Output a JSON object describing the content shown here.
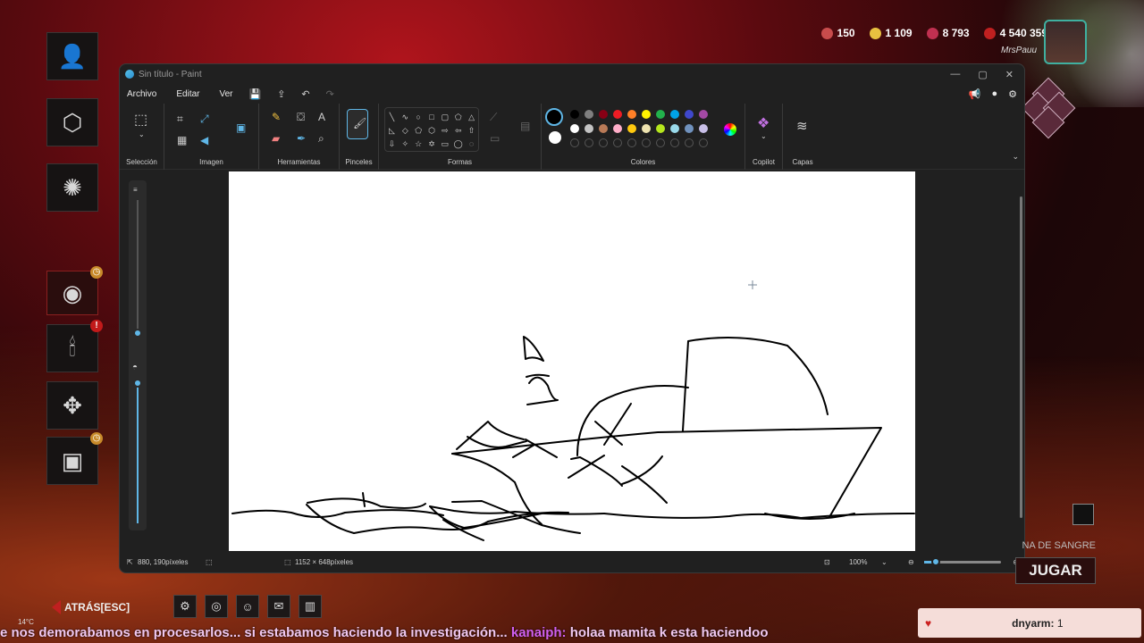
{
  "game": {
    "currencies": [
      {
        "icon": "shards-icon",
        "value": "150",
        "color": "#c84c4c"
      },
      {
        "icon": "iridescent-shards-icon",
        "value": "1 109",
        "color": "#e8c040"
      },
      {
        "icon": "auric-cells-icon",
        "value": "8 793",
        "color": "#c03050"
      },
      {
        "icon": "bloodpoints-icon",
        "value": "4 540 359",
        "color": "#c02020"
      }
    ],
    "player_name": "MrsPauu",
    "back_label": "ATRÁS",
    "back_key": "[ESC]",
    "play_label": "JUGAR",
    "bloodweb_label": "NA DE SANGRE"
  },
  "paint": {
    "window_title": "Sin título - Paint",
    "menus": [
      "Archivo",
      "Editar",
      "Ver"
    ],
    "groups": {
      "selection": "Selección",
      "image": "Imagen",
      "tools": "Herramientas",
      "brushes": "Pinceles",
      "shapes": "Formas",
      "colors": "Colores",
      "copilot": "Copilot",
      "layers": "Capas"
    },
    "palette_row1": [
      "#000000",
      "#7f7f7f",
      "#880015",
      "#ed1c24",
      "#ff7f27",
      "#fff200",
      "#22b14c",
      "#00a2e8",
      "#3f48cc",
      "#a349a4"
    ],
    "palette_row2": [
      "#ffffff",
      "#c3c3c3",
      "#b97a57",
      "#ffaec9",
      "#ffc90e",
      "#efe4b0",
      "#b5e61d",
      "#99d9ea",
      "#7092be",
      "#c8bfe7"
    ],
    "status": {
      "cursor_pos": "880, 190píxeles",
      "canvas_size": "1152 × 648píxeles",
      "zoom": "100%"
    }
  },
  "chat": {
    "ticker_text": "e nos demorabamos en procesarlos... si estabamos haciendo la investigación...",
    "ticker_user": "kanaiph:",
    "ticker_msg": "holaa mamita k esta haciendoo",
    "weather": "14°C",
    "alert_name": "dnyarm:",
    "alert_count": "1"
  }
}
